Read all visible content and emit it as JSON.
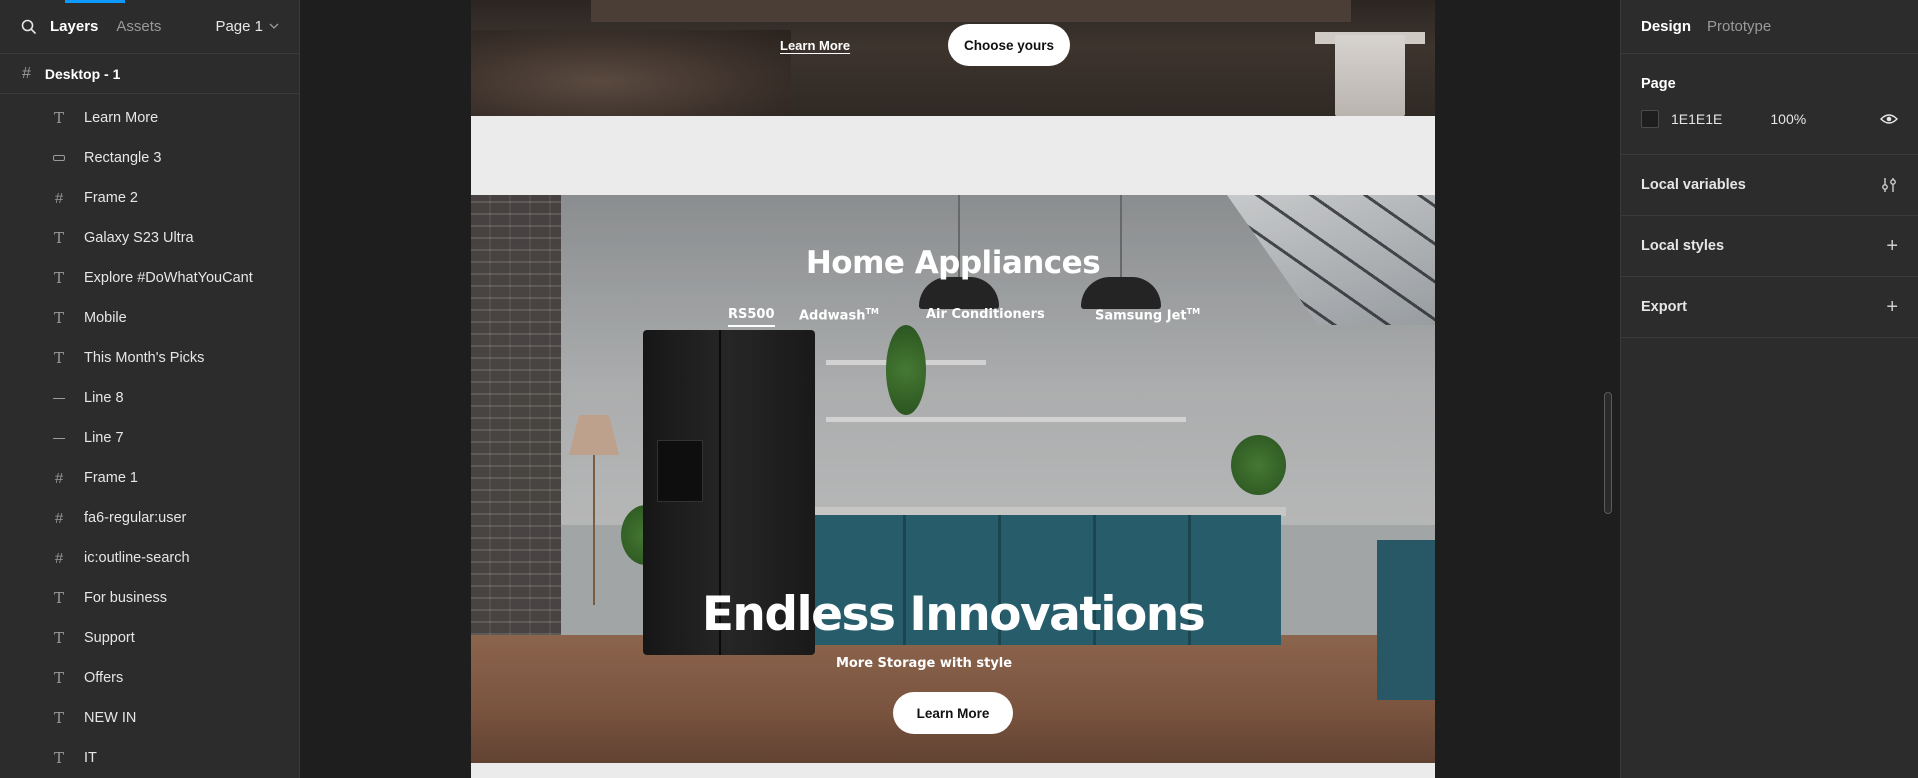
{
  "layers_panel": {
    "tabs": {
      "layers": "Layers",
      "assets": "Assets"
    },
    "page_selector": "Page 1",
    "root_frame": "Desktop - 1",
    "items": [
      {
        "name": "Learn More",
        "type": "text"
      },
      {
        "name": "Rectangle 3",
        "type": "rect"
      },
      {
        "name": "Frame 2",
        "type": "frame"
      },
      {
        "name": "Galaxy S23 Ultra",
        "type": "text"
      },
      {
        "name": "Explore #DoWhatYouCant",
        "type": "text"
      },
      {
        "name": "Mobile",
        "type": "text"
      },
      {
        "name": "This Month's Picks",
        "type": "text"
      },
      {
        "name": "Line 8",
        "type": "line"
      },
      {
        "name": "Line 7",
        "type": "line"
      },
      {
        "name": "Frame 1",
        "type": "frame"
      },
      {
        "name": "fa6-regular:user",
        "type": "frame"
      },
      {
        "name": "ic:outline-search",
        "type": "frame"
      },
      {
        "name": "For business",
        "type": "text"
      },
      {
        "name": "Support",
        "type": "text"
      },
      {
        "name": "Offers",
        "type": "text"
      },
      {
        "name": "NEW IN",
        "type": "text"
      },
      {
        "name": "IT",
        "type": "text"
      }
    ]
  },
  "canvas": {
    "top_section": {
      "learn_more": "Learn More",
      "choose_yours": "Choose yours"
    },
    "hero": {
      "title": "Home Appliances",
      "tabs": [
        {
          "label": "RS500",
          "tm": ""
        },
        {
          "label": "Addwash",
          "tm": "TM"
        },
        {
          "label": "Air Conditioners",
          "tm": ""
        },
        {
          "label": "Samsung Jet",
          "tm": "TM"
        }
      ],
      "headline": "Endless Innovations",
      "subheadline": "More Storage with style",
      "cta": "Learn More"
    }
  },
  "design_panel": {
    "tabs": {
      "design": "Design",
      "prototype": "Prototype"
    },
    "page": {
      "title": "Page",
      "color": "1E1E1E",
      "opacity": "100%"
    },
    "local_variables": "Local variables",
    "local_styles": "Local styles",
    "export": "Export"
  },
  "colors": {
    "canvas_bg": "#1e1e1e",
    "panel_bg": "#2c2c2c",
    "accent": "#0d99ff"
  }
}
